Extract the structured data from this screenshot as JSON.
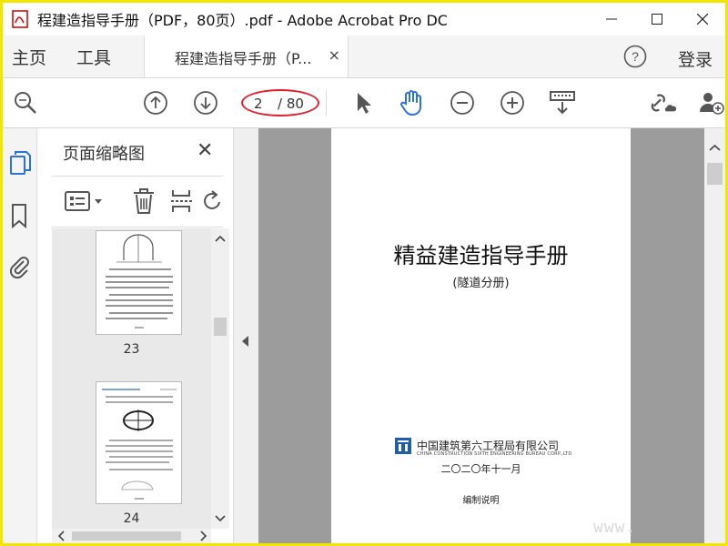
{
  "window": {
    "title": "程建造指导手册（PDF，80页）.pdf - Adobe Acrobat Pro DC"
  },
  "menubar": {
    "home": "主页",
    "tools": "工具",
    "tab_label": "程建造指导手册（P...",
    "tab_close": "×",
    "login": "登录"
  },
  "toolbar": {
    "page_current": "2",
    "page_total": "/ 80"
  },
  "panel": {
    "title": "页面缩略图",
    "close": "✕",
    "thumbnails": [
      {
        "label": "23"
      },
      {
        "label": "24"
      }
    ]
  },
  "document": {
    "title": "精益建造指导手册",
    "subtitle": "(隧道分册)",
    "company_cn": "中国建筑第六工程局有限公司",
    "company_en": "CHINA CONSTRUCTION SIXTH ENGINEERING BUREAU CORP.,LTD",
    "date": "二〇二〇年十一月",
    "note": "编制说明"
  },
  "watermark": "www.",
  "colors": {
    "frame": "#f2e600",
    "accent_blue": "#2a73d8",
    "highlight_oval": "#e2202c",
    "viewer_bg": "#9c9c9c"
  }
}
